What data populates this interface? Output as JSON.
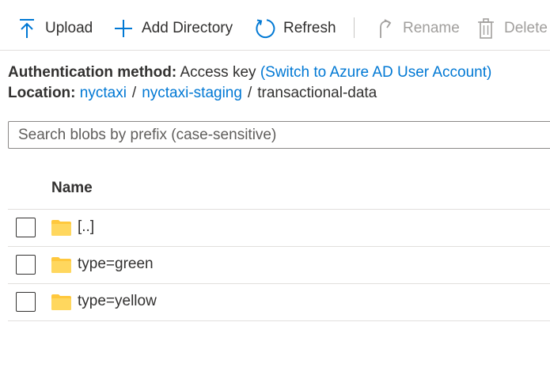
{
  "toolbar": {
    "upload_label": "Upload",
    "add_directory_label": "Add Directory",
    "refresh_label": "Refresh",
    "rename_label": "Rename",
    "delete_label": "Delete"
  },
  "info": {
    "auth_label": "Authentication method:",
    "auth_value": "Access key",
    "auth_switch_link": "(Switch to Azure AD User Account)",
    "location_label": "Location:",
    "location_path": [
      "nyctaxi",
      "nyctaxi-staging",
      "transactional-data"
    ]
  },
  "search": {
    "placeholder": "Search blobs by prefix (case-sensitive)",
    "value": ""
  },
  "table": {
    "header_name": "Name",
    "rows": [
      {
        "name": "[..]",
        "icon": "folder-icon"
      },
      {
        "name": "type=green",
        "icon": "folder-icon"
      },
      {
        "name": "type=yellow",
        "icon": "folder-icon"
      }
    ]
  },
  "colors": {
    "accent": "#0078d4",
    "text": "#323130",
    "disabled": "#a19f9d",
    "folder": "#ffc83d",
    "border": "#e1dfdd"
  }
}
